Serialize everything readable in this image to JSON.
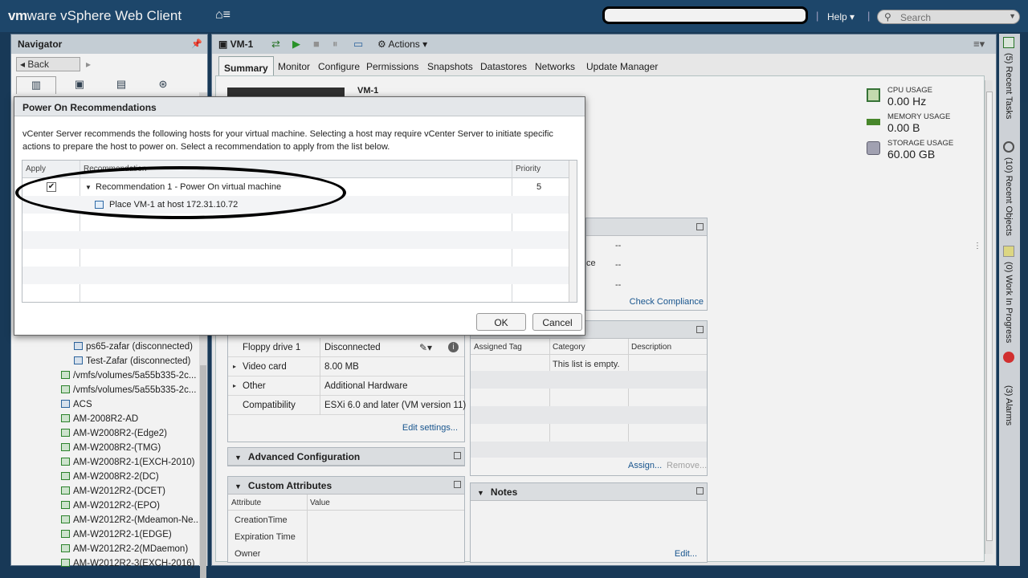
{
  "app": {
    "brand_vm": "vm",
    "brand_ware": "ware",
    "brand_product": " vSphere Web Client",
    "help_label": "Help",
    "search_placeholder": "Search"
  },
  "navigator": {
    "title": "Navigator",
    "back_label": "Back",
    "tree": [
      {
        "label": "ps65-zafar (disconnected)",
        "indent": 78,
        "type": "vm"
      },
      {
        "label": "Test-Zafar (disconnected)",
        "indent": 78,
        "type": "vm"
      },
      {
        "label": "/vmfs/volumes/5a55b335-2c...",
        "indent": 62,
        "type": "vm-on"
      },
      {
        "label": "/vmfs/volumes/5a55b335-2c...",
        "indent": 62,
        "type": "vm-on"
      },
      {
        "label": "ACS",
        "indent": 62,
        "type": "vm"
      },
      {
        "label": "AM-2008R2-AD",
        "indent": 62,
        "type": "vm-on"
      },
      {
        "label": "AM-W2008R2-(Edge2)",
        "indent": 62,
        "type": "vm-on"
      },
      {
        "label": "AM-W2008R2-(TMG)",
        "indent": 62,
        "type": "vm-on"
      },
      {
        "label": "AM-W2008R2-1(EXCH-2010)",
        "indent": 62,
        "type": "vm-on"
      },
      {
        "label": "AM-W2008R2-2(DC)",
        "indent": 62,
        "type": "vm-on"
      },
      {
        "label": "AM-W2012R2-(DCET)",
        "indent": 62,
        "type": "vm-on"
      },
      {
        "label": "AM-W2012R2-(EPO)",
        "indent": 62,
        "type": "vm-on"
      },
      {
        "label": "AM-W2012R2-(Mdeamon-Ne...",
        "indent": 62,
        "type": "vm-on"
      },
      {
        "label": "AM-W2012R2-1(EDGE)",
        "indent": 62,
        "type": "vm-on"
      },
      {
        "label": "AM-W2012R2-2(MDaemon)",
        "indent": 62,
        "type": "vm-on"
      },
      {
        "label": "AM-W2012R2-3(EXCH-2016)",
        "indent": 62,
        "type": "vm-on"
      }
    ]
  },
  "vm": {
    "title": "VM-1",
    "name": "VM-1",
    "actions_label": "Actions"
  },
  "tabs": [
    "Summary",
    "Monitor",
    "Configure",
    "Permissions",
    "Snapshots",
    "Datastores",
    "Networks",
    "Update Manager"
  ],
  "usage": [
    {
      "label": "CPU USAGE",
      "value": "0.00 Hz"
    },
    {
      "label": "MEMORY USAGE",
      "value": "0.00 B"
    },
    {
      "label": "STORAGE USAGE",
      "value": "60.00 GB"
    }
  ],
  "policies_panel": {
    "rows": [
      "--",
      "--",
      "--"
    ],
    "partial_label": "ce",
    "link": "Check Compliance"
  },
  "hardware": {
    "rows": [
      {
        "key": "Floppy drive 1",
        "value": "Disconnected"
      },
      {
        "key": "Video card",
        "value": "8.00 MB"
      },
      {
        "key": "Other",
        "value": "Additional Hardware"
      },
      {
        "key": "Compatibility",
        "value": "ESXi 6.0 and later (VM version 11)"
      }
    ],
    "edit_link": "Edit settings..."
  },
  "tags": {
    "columns": [
      "Assigned Tag",
      "Category",
      "Description"
    ],
    "empty": "This list is empty.",
    "assign": "Assign...",
    "remove": "Remove..."
  },
  "advanced": {
    "title": "Advanced Configuration"
  },
  "custom_attrs": {
    "title": "Custom Attributes",
    "columns": [
      "Attribute",
      "Value"
    ],
    "rows": [
      "CreationTime",
      "Expiration Time",
      "Owner"
    ]
  },
  "notes": {
    "title": "Notes",
    "edit": "Edit..."
  },
  "sidebar": {
    "recent_tasks": "(5) Recent Tasks",
    "recent_objects": "(10) Recent Objects",
    "work_in_progress": "(0) Work In Progress",
    "alarms": "(3) Alarms"
  },
  "dialog": {
    "title": "Power On Recommendations",
    "message": "vCenter Server recommends the following hosts for your virtual machine. Selecting a host may require vCenter Server to initiate specific actions to prepare the host to power on. Select a recommendation to apply from the list below.",
    "columns": {
      "apply": "Apply",
      "recommendation": "Recommendation",
      "priority": "Priority"
    },
    "recommendation": "Recommendation 1 - Power On virtual machine",
    "priority": "5",
    "action": "Place VM-1 at host 172.31.10.72",
    "ok": "OK",
    "cancel": "Cancel"
  }
}
